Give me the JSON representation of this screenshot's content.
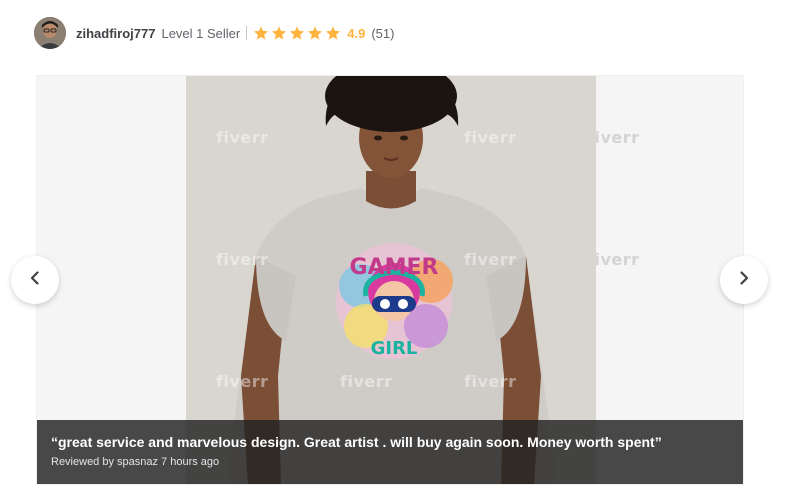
{
  "seller": {
    "username": "zihadfiroj777",
    "level": "Level 1 Seller",
    "rating": "4.9",
    "review_count": "(51)",
    "stars": 5
  },
  "gallery": {
    "watermark_text": "fiverr",
    "review": {
      "quote": "“great service and marvelous design. Great artist . will buy again soon. Money worth spent”",
      "reviewer": "Reviewed by spasnaz 7 hours ago"
    },
    "design_text_top": "GAMER",
    "design_text_bottom": "GIRL"
  },
  "colors": {
    "star": "#ffb33e",
    "text_dark": "#404145",
    "text_muted": "#62646a"
  },
  "icons": {
    "prev": "chevron-left-icon",
    "next": "chevron-right-icon",
    "star": "star-icon"
  }
}
